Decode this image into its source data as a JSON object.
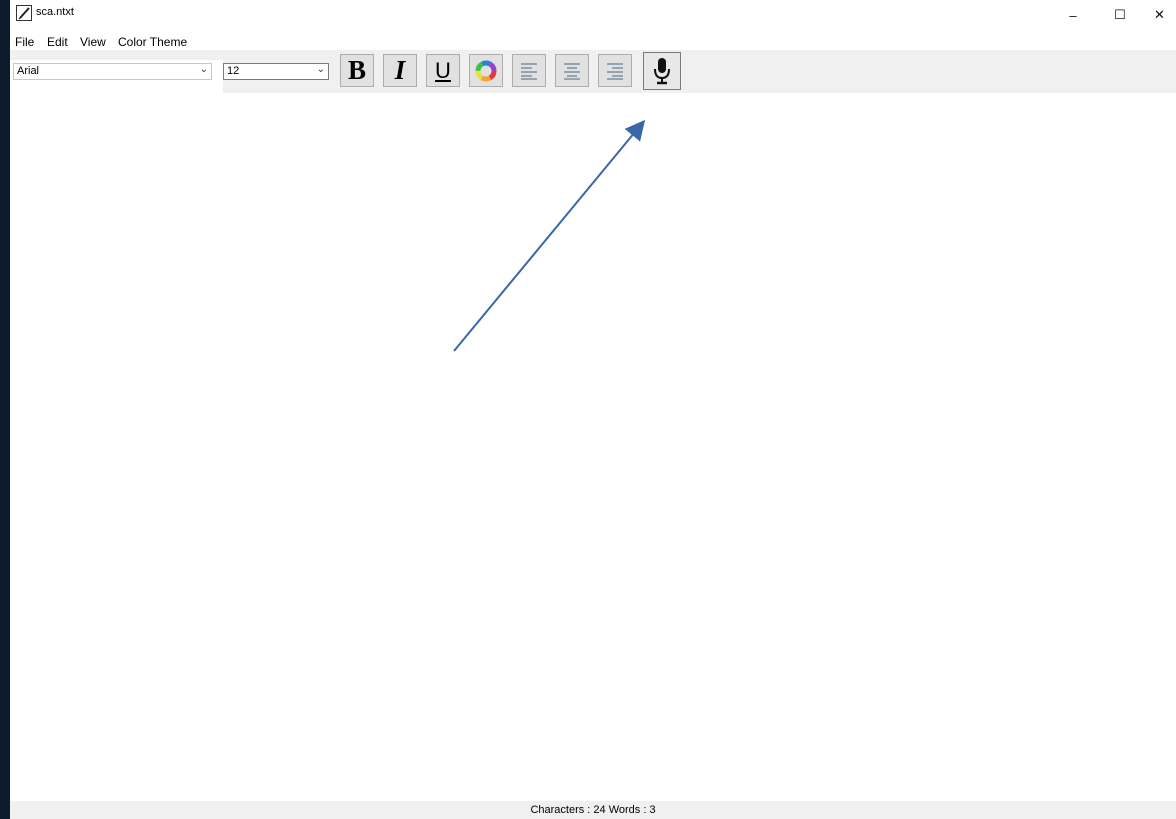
{
  "window": {
    "title": "sca.ntxt",
    "minimize_glyph": "–",
    "maximize_glyph": "☐",
    "close_glyph": "✕"
  },
  "menu": {
    "items": [
      "File",
      "Edit",
      "View",
      "Color Theme"
    ]
  },
  "toolbar": {
    "font_family": "Arial",
    "font_size": "12",
    "bold_label": "B",
    "italic_label": "I",
    "underline_label": "U",
    "icons": [
      "color-wheel-icon",
      "align-left-icon",
      "align-center-icon",
      "align-right-icon",
      "microphone-icon"
    ]
  },
  "status": {
    "text": "Characters : 24 Words : 3"
  },
  "colors": {
    "desktop": "#0c1a2c",
    "annotation_arrow": "#3a67a8",
    "toolbar_bg": "#f0f0f0"
  }
}
